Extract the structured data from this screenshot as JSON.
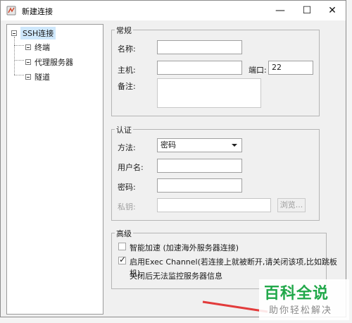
{
  "window": {
    "title": "新建连接",
    "minimize_glyph": "—",
    "maximize_glyph": "☐",
    "close_glyph": "✕"
  },
  "tree": {
    "root": "SSH连接",
    "children": [
      "终端",
      "代理服务器",
      "隧道"
    ]
  },
  "general": {
    "legend": "常规",
    "name_label": "名称:",
    "name_value": "",
    "host_label": "主机:",
    "host_value": "",
    "port_label": "端口:",
    "port_value": "22",
    "note_label": "备注:",
    "note_value": ""
  },
  "auth": {
    "legend": "认证",
    "method_label": "方法:",
    "method_value": "密码",
    "user_label": "用户名:",
    "user_value": "",
    "password_label": "密码:",
    "password_value": "",
    "key_label": "私钥:",
    "key_value": "",
    "browse_label": "浏览..."
  },
  "advanced": {
    "legend": "高级",
    "smart_accel_label": "智能加速 (加速海外服务器连接)",
    "smart_accel_checked": false,
    "exec_channel_label": "启用Exec Channel(若连接上就被断开,请关闭该项,比如跳板机)",
    "exec_channel_checked": true,
    "exec_channel_note": "关闭后无法监控服务器信息"
  },
  "watermark": {
    "main": "百科全说",
    "sub": "助你轻松解决",
    "color": "#21a84a"
  },
  "colors": {
    "window_bg": "#f0f0f0",
    "selection": "#cfe8fc",
    "arrow": "#e23b3b"
  }
}
